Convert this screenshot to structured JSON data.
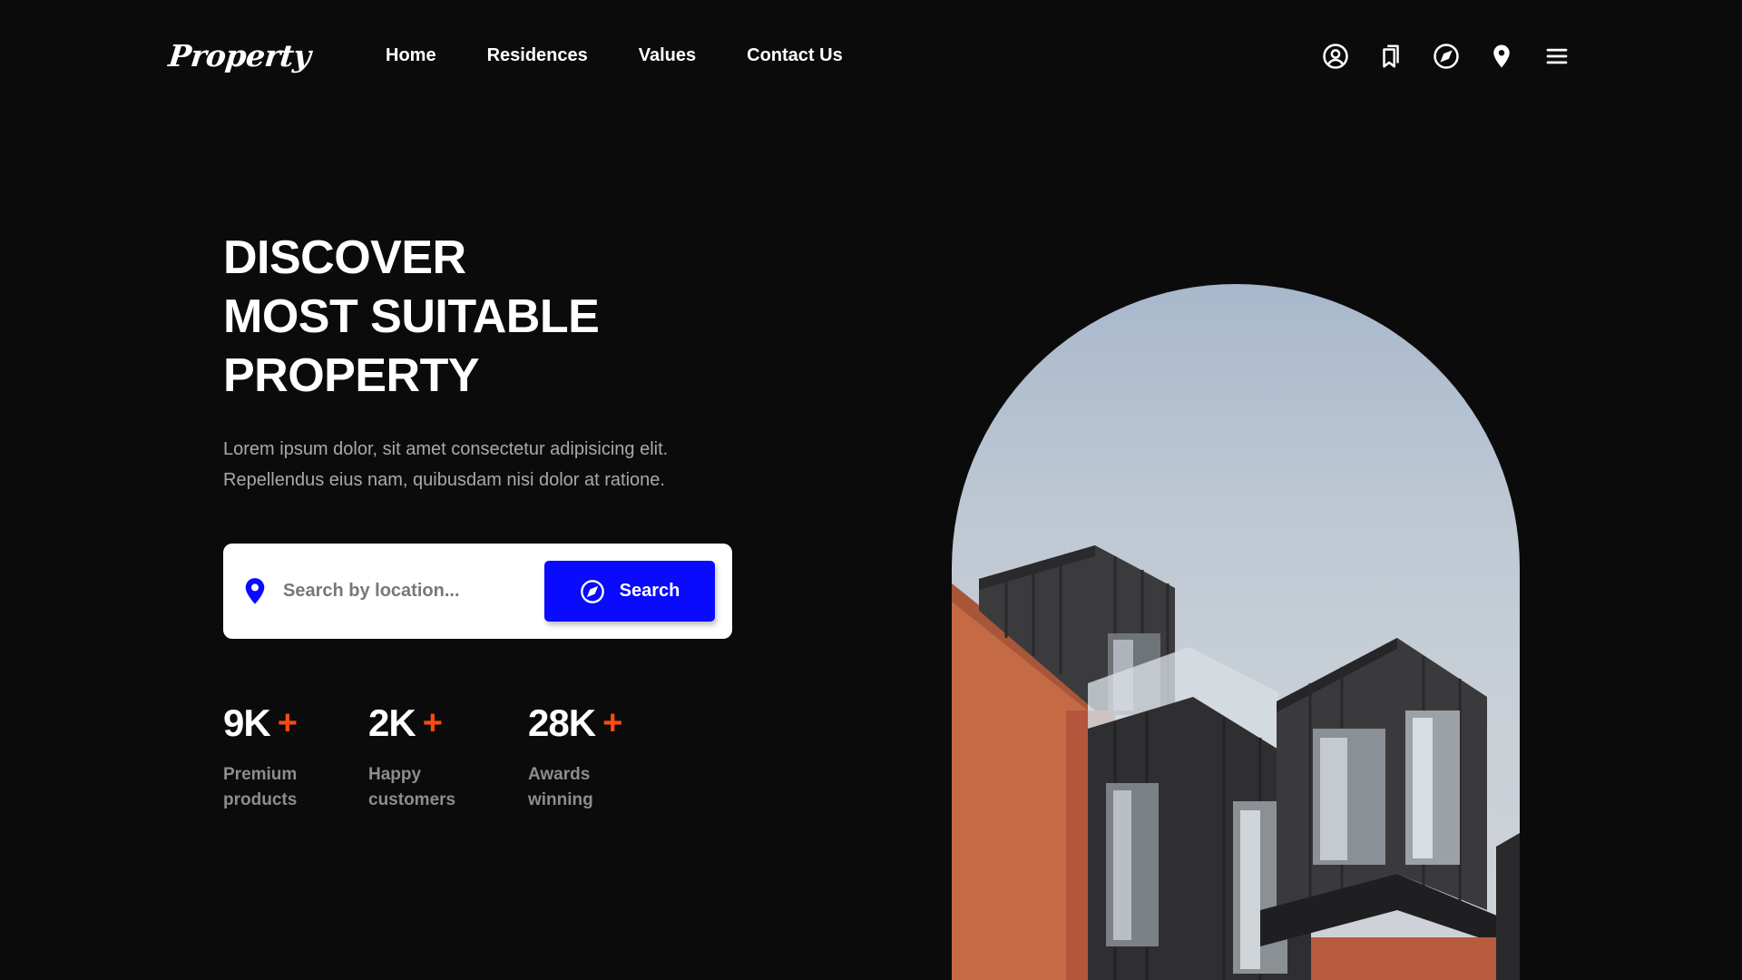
{
  "brand": {
    "name": "Property"
  },
  "nav": {
    "links": [
      "Home",
      "Residences",
      "Values",
      "Contact Us"
    ],
    "icons": [
      "user-circle-icon",
      "bookmark-icon",
      "compass-icon",
      "map-pin-icon",
      "menu-icon"
    ]
  },
  "hero": {
    "title_lines": [
      "DISCOVER",
      "MOST SUITABLE",
      "PROPERTY"
    ],
    "description_lines": [
      "Lorem ipsum dolor, sit amet consectetur adipisicing elit.",
      "Repellendus eius nam, quibusdam nisi dolor at ratione."
    ],
    "image": "modern-apartment-building-photo"
  },
  "search": {
    "placeholder": "Search by location...",
    "value": "",
    "button_label": "Search",
    "pin_icon": "map-pin-icon",
    "button_icon": "compass-icon"
  },
  "stats": [
    {
      "value": "9K",
      "suffix": "+",
      "label_lines": [
        "Premium",
        "products"
      ]
    },
    {
      "value": "2K",
      "suffix": "+",
      "label_lines": [
        "Happy",
        "customers"
      ]
    },
    {
      "value": "28K",
      "suffix": "+",
      "label_lines": [
        "Awards",
        "winning"
      ]
    }
  ],
  "colors": {
    "background": "#0b0b0c",
    "accent": "#0a0aff",
    "plus": "#ff4a12",
    "muted_text": "#a9a9ad"
  }
}
